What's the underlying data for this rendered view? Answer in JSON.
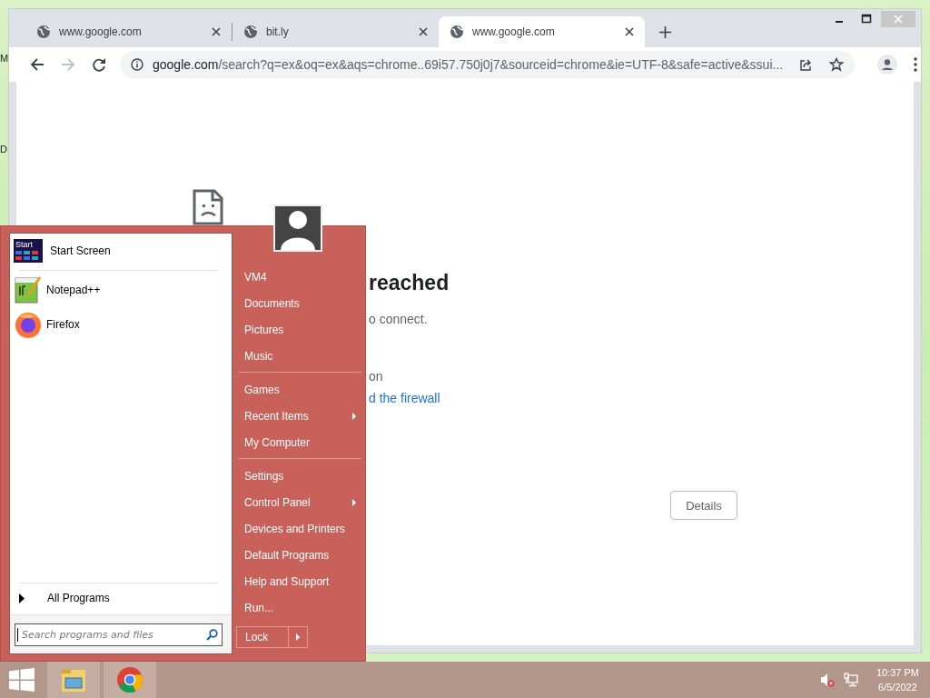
{
  "desktop": {
    "icon_labels": [
      "M",
      "D"
    ]
  },
  "browser": {
    "tabs": [
      {
        "title": "www.google.com",
        "selected": false
      },
      {
        "title": "bit.ly",
        "selected": false
      },
      {
        "title": "www.google.com",
        "selected": true
      }
    ],
    "address": {
      "host": "google.com",
      "path": "/search?q=ex&oq=ex&aqs=chrome..69i57.750j0j7&sourceid=chrome&ie=UTF-8&safe=active&ssui..."
    },
    "page": {
      "heading": "reached",
      "lines": [
        {
          "text": "o connect.",
          "kind": "plain"
        },
        {
          "text": "on",
          "kind": "plain"
        },
        {
          "text": "d the firewall",
          "kind": "link"
        }
      ],
      "button": "Details"
    }
  },
  "start_menu": {
    "pinned": [
      {
        "label": "Start Screen",
        "kind": "start-screen",
        "badge": "Start"
      },
      {
        "label": "Notepad++",
        "kind": "notepad"
      },
      {
        "label": "Firefox",
        "kind": "firefox"
      }
    ],
    "all_programs": "All Programs",
    "search": {
      "placeholder": "Search programs and files"
    },
    "groups": [
      [
        {
          "label": "VM4",
          "submenu": false
        },
        {
          "label": "Documents",
          "submenu": false
        },
        {
          "label": "Pictures",
          "submenu": false
        },
        {
          "label": "Music",
          "submenu": false
        }
      ],
      [
        {
          "label": "Games",
          "submenu": false
        },
        {
          "label": "Recent Items",
          "submenu": true
        },
        {
          "label": "My Computer",
          "submenu": false
        }
      ],
      [
        {
          "label": "Settings",
          "submenu": false
        },
        {
          "label": "Control Panel",
          "submenu": true
        },
        {
          "label": "Devices and Printers",
          "submenu": false
        },
        {
          "label": "Default Programs",
          "submenu": false
        },
        {
          "label": "Help and Support",
          "submenu": false
        },
        {
          "label": "Run...",
          "submenu": false
        }
      ]
    ],
    "power": "Lock"
  },
  "taskbar": {
    "apps": [
      {
        "kind": "explorer"
      },
      {
        "kind": "chrome"
      }
    ],
    "clock": {
      "time": "10:37 PM",
      "date": "6/5/2022"
    }
  }
}
